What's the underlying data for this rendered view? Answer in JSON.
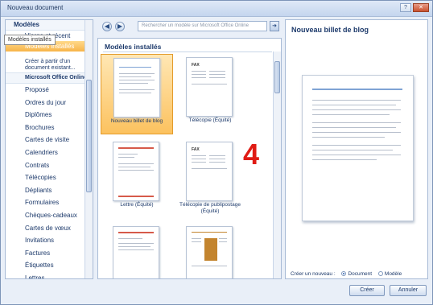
{
  "window": {
    "title": "Nouveau document"
  },
  "sidebar": {
    "section_header": "Modèles",
    "items": [
      "Vierge et récent",
      "Modèles installés"
    ],
    "tooltip": "Modèles installés",
    "create_from": "Créer à partir d'un document existant...",
    "online_header": "Microsoft Office Online",
    "online_items": [
      "Proposé",
      "Ordres du jour",
      "Diplômes",
      "Brochures",
      "Cartes de visite",
      "Calendriers",
      "Contrats",
      "Télécopies",
      "Dépliants",
      "Formulaires",
      "Chèques-cadeaux",
      "Cartes de vœux",
      "Invitations",
      "Factures",
      "Étiquettes",
      "Lettres"
    ]
  },
  "navbar": {
    "back_icon": "back-arrow-icon",
    "forward_icon": "forward-arrow-icon",
    "search_placeholder": "Rechercher un modèle sur Microsoft Office Online",
    "search_go_icon": "arrow-right-icon"
  },
  "gallery": {
    "title": "Modèles installés",
    "templates": [
      {
        "label": "Nouveau billet de blog",
        "selected": true
      },
      {
        "label": "Télécopie (Équité)",
        "selected": false
      },
      {
        "label": "Lettre (Équité)",
        "selected": false
      },
      {
        "label": "Télécopie de publipostage (Équité)",
        "selected": false
      },
      {
        "label": "",
        "selected": false
      },
      {
        "label": "",
        "selected": false
      }
    ]
  },
  "annotation": "4",
  "preview": {
    "title": "Nouveau billet de blog",
    "create_new_label": "Créer un nouveau :",
    "option_document": "Document",
    "option_template": "Modèle",
    "selected_option": "Document"
  },
  "buttons": {
    "create": "Créer",
    "cancel": "Annuler"
  },
  "colors": {
    "accent": "#f7b44a",
    "annotation": "#e01b14",
    "header_text": "#1d3a6b"
  }
}
